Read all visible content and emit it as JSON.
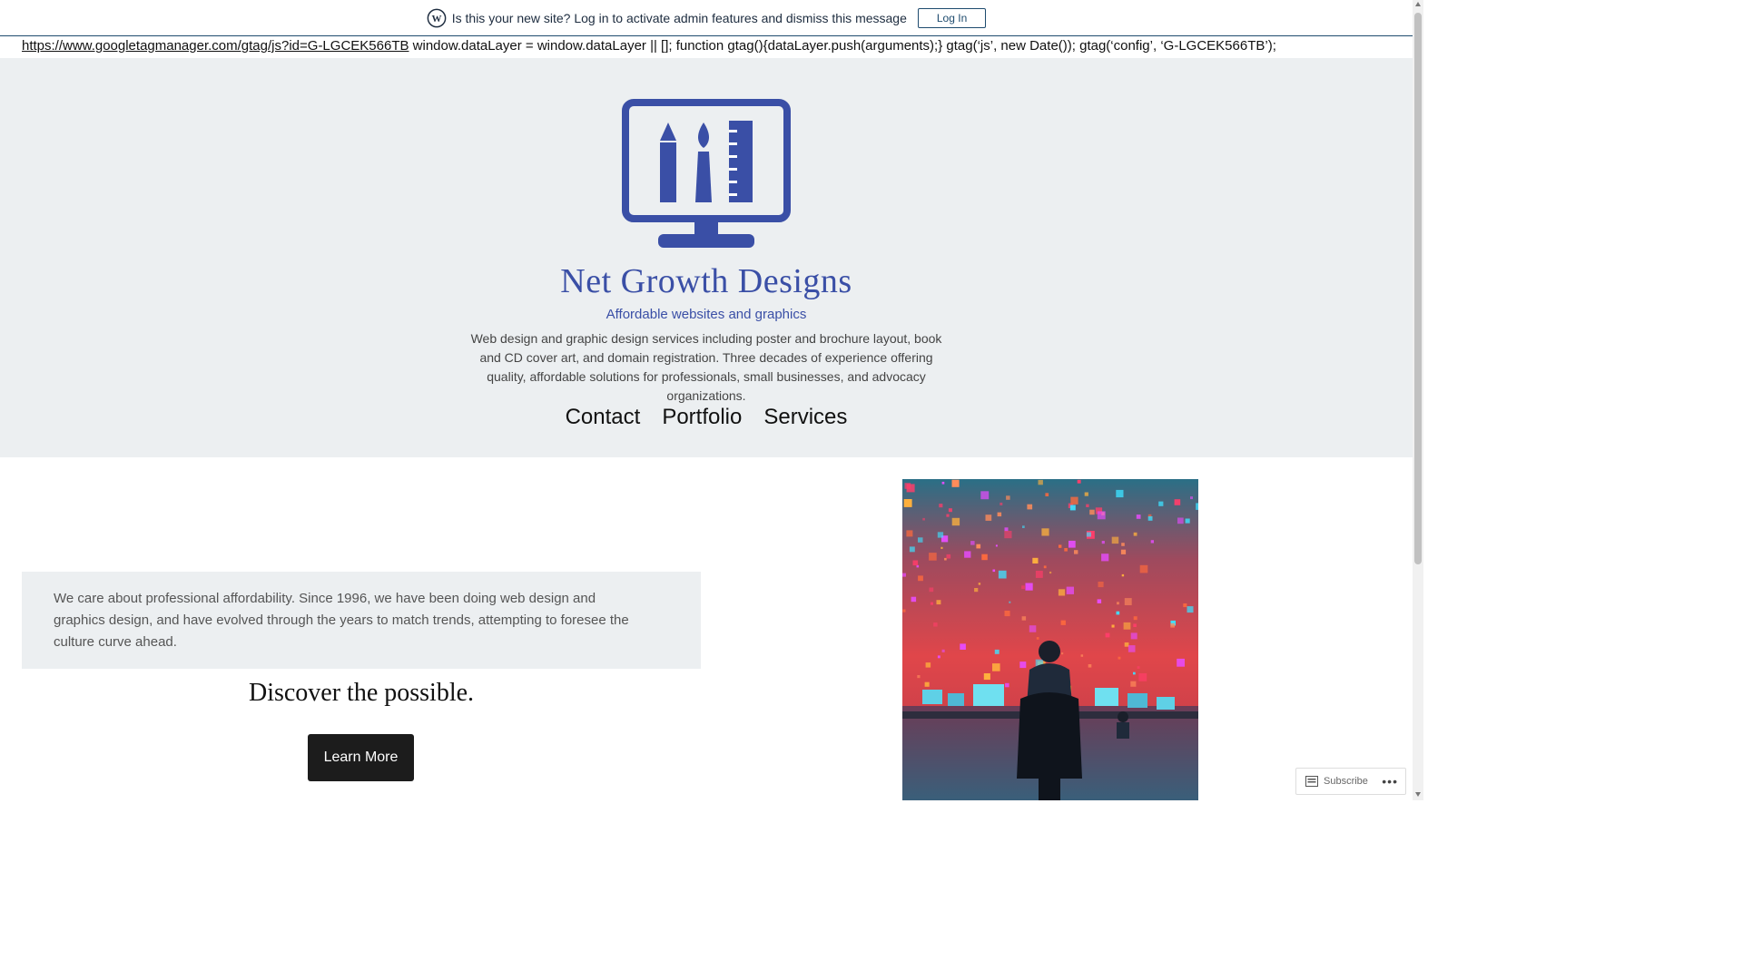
{
  "notice": {
    "message": "Is this your new site? Log in to activate admin features and dismiss this message",
    "login_label": "Log In"
  },
  "script_line": {
    "link": "https://www.googletagmanager.com/gtag/js?id=G-LGCEK566TB",
    "code": " window.dataLayer = window.dataLayer || []; function gtag(){dataLayer.push(arguments);} gtag(‘js’, new Date()); gtag(‘config’, ‘G-LGCEK566TB’);"
  },
  "site": {
    "title": "Net Growth Designs",
    "tagline": "Affordable websites and graphics",
    "description": "Web design and graphic design services including poster and brochure layout, book and CD cover art, and domain registration. Three decades of experience offering quality, affordable solutions for professionals, small businesses, and advocacy organizations."
  },
  "nav": {
    "items": [
      "Contact",
      "Portfolio",
      "Services"
    ]
  },
  "main": {
    "intro": "We care about professional affordability. Since 1996, we have been doing web design and graphics design, and have evolved through the years to match trends, attempting to foresee the culture curve ahead.",
    "heading": "Discover the possible.",
    "cta_label": "Learn More"
  },
  "widget": {
    "subscribe_label": "Subscribe",
    "more_label": "•••"
  },
  "colors": {
    "brand": "#3a4fa6",
    "header_bg": "#eceff1",
    "button_bg": "#1c1c1c"
  },
  "icons": {
    "wordpress": "wordpress-icon",
    "logo": "monitor-tools-logo",
    "subscribe": "reader-icon"
  }
}
